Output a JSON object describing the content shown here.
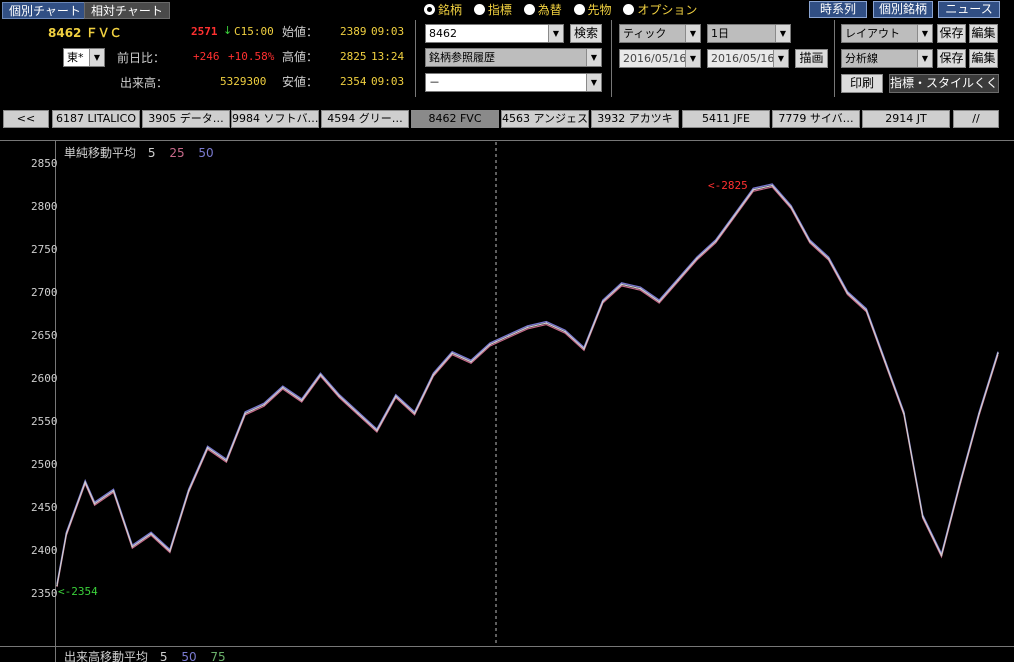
{
  "tabs": {
    "individual": "個別チャート",
    "relative": "相対チャート"
  },
  "right_buttons": {
    "timeseries": "時系列",
    "individual_stock": "個別銘柄",
    "news": "ニュース"
  },
  "quote": {
    "code_name": "8462 ＦＶＣ",
    "price": "2571",
    "arrow": "↓",
    "c_time": "C15:00",
    "market": "東*",
    "open_label": "始値：",
    "open_value": "2389",
    "open_time": "09:03",
    "high_label": "高値：",
    "high_value": "2825",
    "high_time": "13:24",
    "low_label": "安値：",
    "low_value": "2354",
    "low_time": "09:03",
    "change_label": "前日比：",
    "change_value": "+246",
    "change_pct": "+10.58%",
    "volume_label": "出来高：",
    "volume_value": "5329300"
  },
  "radio": {
    "stock": "銘柄",
    "index": "指標",
    "fx": "為替",
    "futures": "先物",
    "option": "オプション"
  },
  "search": {
    "code": "8462",
    "button": "検索",
    "history": "銘柄参照履歴",
    "third": "－"
  },
  "period": {
    "tick": "ティック",
    "span": "1日",
    "date_from": "2016/05/16",
    "date_to": "2016/05/16",
    "draw": "描画"
  },
  "layout": {
    "layout": "レイアウト",
    "save1": "保存",
    "edit1": "編集",
    "analysis": "分析線",
    "save2": "保存",
    "edit2": "編集",
    "print": "印刷",
    "indicator": "指標・スタイルくく"
  },
  "stock_tabs": {
    "prev": "<<",
    "items": [
      "6187 LITALICO",
      "3905 データ…",
      "9984 ソフトバ…",
      "4594 グリー…",
      "8462 FVC",
      "4563 アンジェス",
      "3932 アカツキ",
      "5411 JFE",
      "7779 サイバ…",
      "2914 JT"
    ],
    "next": "//"
  },
  "chart_labels": {
    "ma_title": "単純移動平均",
    "ma5": "5",
    "ma25": "25",
    "ma50": "50",
    "high_marker": "<-2825",
    "low_marker": "<-2354",
    "vol_title": "出来高移動平均",
    "vma5": "5",
    "vma50": "50",
    "vma75": "75"
  },
  "colors": {
    "up": "#ff3030",
    "accent": "#f0d040",
    "ma5": "#cfcfcf",
    "ma25": "#c86a8a",
    "ma50": "#7a7ad0",
    "vol75": "#6ab06a"
  },
  "chart_data": {
    "type": "line",
    "title": "",
    "ylabel": "",
    "ylim": [
      2325,
      2860
    ],
    "yticks": [
      2350,
      2400,
      2450,
      2500,
      2550,
      2600,
      2650,
      2700,
      2750,
      2800,
      2850
    ],
    "x": [
      0,
      1,
      3,
      4,
      6,
      8,
      10,
      12,
      14,
      16,
      18,
      20,
      22,
      24,
      26,
      28,
      30,
      32,
      34,
      36,
      38,
      40,
      42,
      44,
      46,
      48,
      50,
      52,
      54,
      56,
      58,
      60,
      62,
      64,
      66,
      68,
      70,
      72,
      74,
      76,
      78,
      80,
      82,
      84,
      86,
      88,
      90,
      92,
      94,
      96,
      98,
      100
    ],
    "values": [
      2360,
      2420,
      2480,
      2455,
      2470,
      2405,
      2420,
      2400,
      2470,
      2520,
      2505,
      2560,
      2570,
      2590,
      2575,
      2605,
      2580,
      2560,
      2540,
      2580,
      2560,
      2605,
      2630,
      2620,
      2640,
      2650,
      2660,
      2665,
      2655,
      2635,
      2690,
      2710,
      2705,
      2690,
      2715,
      2740,
      2760,
      2790,
      2820,
      2825,
      2800,
      2760,
      2740,
      2700,
      2680,
      2620,
      2560,
      2440,
      2395,
      2480,
      2560,
      2630
    ],
    "annotations": [
      "<-2825",
      "<-2354"
    ]
  }
}
